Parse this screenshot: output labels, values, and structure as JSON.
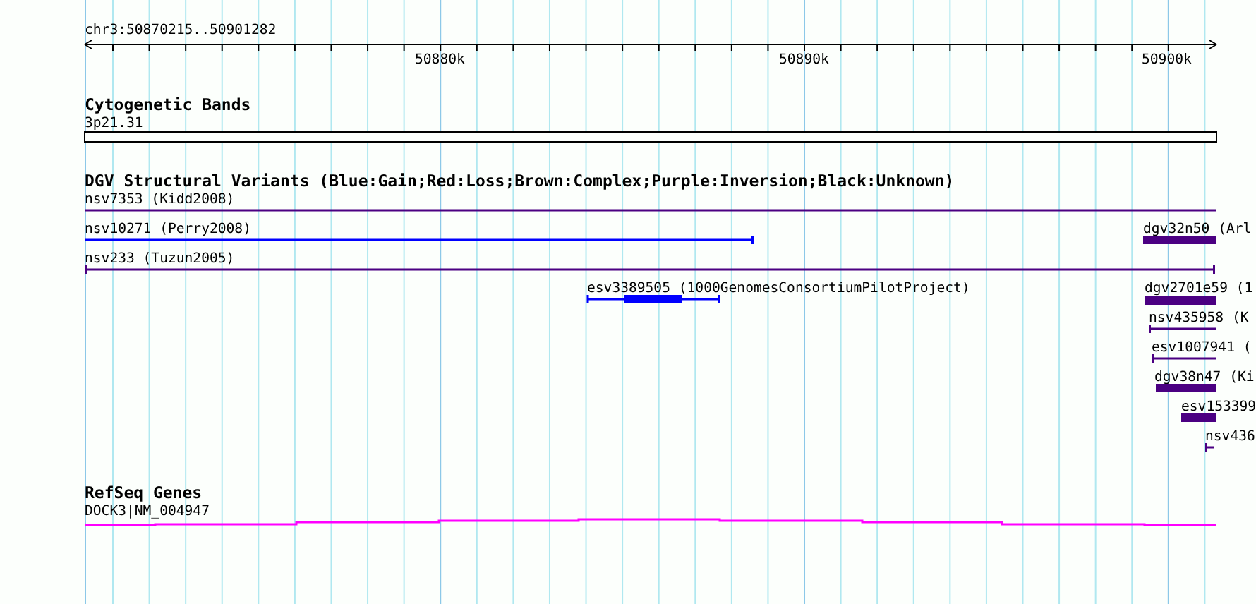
{
  "ruler": {
    "position": "chr3:50870215..50901282",
    "ticks": [
      "50880k",
      "50890k",
      "50900k"
    ]
  },
  "tracks": [
    {
      "kind": "bands",
      "title": "Cytogenetic Bands",
      "items": [
        {
          "label": "3p21.31"
        }
      ]
    },
    {
      "kind": "variants",
      "title": "DGV Structural Variants (Blue:Gain;Red:Loss;Brown:Complex;Purple:Inversion;Black:Unknown)",
      "items": [
        {
          "label": "nsv7353 (Kidd2008)",
          "kind": "line",
          "color": "#4b0082"
        },
        {
          "label": "nsv10271 (Perry2008)",
          "kind": "line",
          "color": "#0000ff"
        },
        {
          "label": "dgv32n50 (Arl",
          "kind": "bar",
          "color": "#4b0082"
        },
        {
          "label": "nsv233 (Tuzun2005)",
          "kind": "line",
          "color": "#4b0082"
        },
        {
          "label": "esv3389505 (1000GenomesConsortiumPilotProject)",
          "kind": "gapped",
          "color": "#0000ff"
        },
        {
          "label": "dgv2701e59 (1",
          "kind": "bar",
          "color": "#4b0082"
        },
        {
          "label": "nsv435958 (K",
          "kind": "line",
          "color": "#4b0082"
        },
        {
          "label": "esv1007941 (",
          "kind": "line",
          "color": "#4b0082"
        },
        {
          "label": "dgv38n47 (Ki",
          "kind": "bar",
          "color": "#4b0082"
        },
        {
          "label": "esv153399",
          "kind": "bar",
          "color": "#4b0082"
        },
        {
          "label": "nsv436",
          "kind": "line",
          "color": "#4b0082"
        }
      ]
    },
    {
      "kind": "genes",
      "title": "RefSeq Genes",
      "items": [
        {
          "label": "DOCK3|NM_004947"
        }
      ]
    }
  ]
}
